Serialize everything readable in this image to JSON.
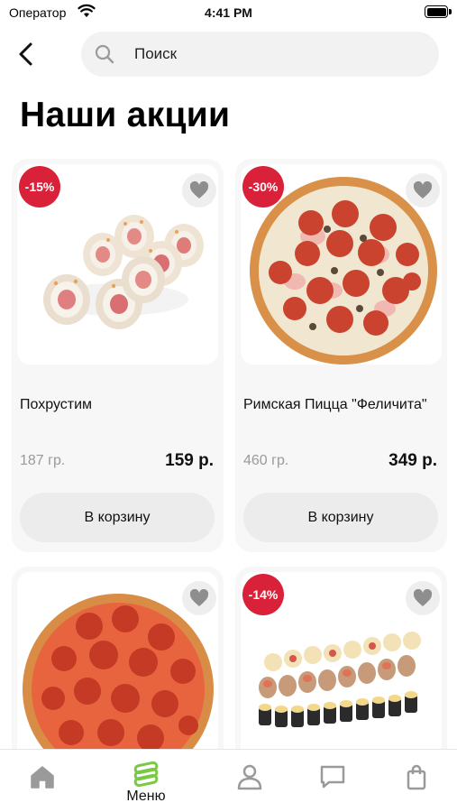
{
  "status_bar": {
    "carrier": "Оператор",
    "time": "4:41 PM"
  },
  "search": {
    "placeholder": "Поиск"
  },
  "page_title": "Наши акции",
  "products": [
    {
      "badge": "-15%",
      "name": "Похрустим",
      "weight": "187 гр.",
      "price": "159 р.",
      "cart_label": "В корзину",
      "image": "sushi-rolls"
    },
    {
      "badge": "-30%",
      "name": "Римская Пицца \"Феличита\"",
      "weight": "460 гр.",
      "price": "349 р.",
      "cart_label": "В корзину",
      "image": "pizza-pepperoni-ham"
    },
    {
      "badge": "",
      "name": "",
      "weight": "",
      "price": "",
      "cart_label": "",
      "image": "pizza-pepperoni"
    },
    {
      "badge": "-14%",
      "name": "",
      "weight": "",
      "price": "",
      "cart_label": "",
      "image": "sushi-set"
    }
  ],
  "tab_bar": {
    "items": [
      {
        "icon": "home-icon",
        "label": ""
      },
      {
        "icon": "menu-icon",
        "label": "Меню",
        "active": true
      },
      {
        "icon": "profile-icon",
        "label": ""
      },
      {
        "icon": "chat-icon",
        "label": ""
      },
      {
        "icon": "bag-icon",
        "label": ""
      }
    ]
  },
  "colors": {
    "badge": "#d9223a",
    "accent": "#7ac943",
    "card_bg": "#f7f7f7",
    "button_bg": "#ececec"
  }
}
